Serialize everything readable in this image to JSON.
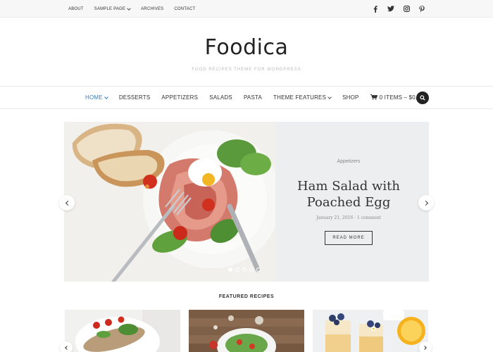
{
  "topbar": {
    "links": [
      "ABOUT",
      "SAMPLE PAGE",
      "ARCHIVES",
      "CONTACT"
    ],
    "social": [
      "facebook-icon",
      "twitter-icon",
      "instagram-icon",
      "pinterest-icon"
    ]
  },
  "header": {
    "logo": "Foodica",
    "tagline": "FOOD RECIPES THEME FOR WORDPRESS"
  },
  "nav": {
    "items": [
      "HOME",
      "DESSERTS",
      "APPETIZERS",
      "SALADS",
      "PASTA",
      "THEME FEATURES",
      "SHOP"
    ],
    "cart": "0 ITEMS – $0.00",
    "accent": "#3a7bbf"
  },
  "slider": {
    "category": "Appetizers",
    "title_line1": "Ham Salad with",
    "title_line2": "Poached Egg",
    "meta": "January 21, 2016 · 1 comment",
    "button": "READ MORE",
    "slide_count": 5,
    "active_slide": 1
  },
  "featured": {
    "title": "FEATURED RECIPES"
  }
}
